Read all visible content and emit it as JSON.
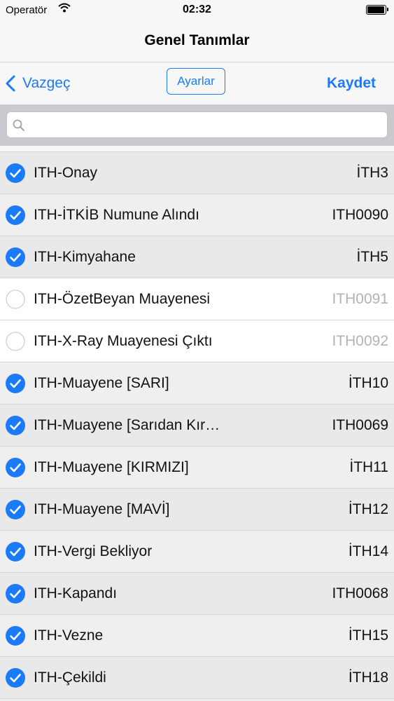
{
  "status_bar": {
    "carrier": "Operatör",
    "time": "02:32",
    "wifi_icon": "wifi-icon",
    "battery_icon": "battery-icon"
  },
  "title": "Genel Tanımlar",
  "toolbar": {
    "back_label": "Vazgeç",
    "settings_label": "Ayarlar",
    "save_label": "Kaydet"
  },
  "search": {
    "placeholder": "",
    "value": ""
  },
  "colors": {
    "accent": "#1a7af8",
    "muted_text": "#b3b3b3"
  },
  "items": [
    {
      "name": "ITH-Onay",
      "code": "İTH3",
      "checked": true
    },
    {
      "name": "ITH-İTKİB Numune Alındı",
      "code": "ITH0090",
      "checked": true
    },
    {
      "name": "ITH-Kimyahane",
      "code": "İTH5",
      "checked": true
    },
    {
      "name": "ITH-ÖzetBeyan Muayenesi",
      "code": "ITH0091",
      "checked": false
    },
    {
      "name": "ITH-X-Ray Muayenesi Çıktı",
      "code": "ITH0092",
      "checked": false
    },
    {
      "name": "ITH-Muayene [SARI]",
      "code": "İTH10",
      "checked": true
    },
    {
      "name": "ITH-Muayene [Sarıdan Kır…",
      "code": "ITH0069",
      "checked": true
    },
    {
      "name": "ITH-Muayene [KIRMIZI]",
      "code": "İTH11",
      "checked": true
    },
    {
      "name": "ITH-Muayene [MAVİ]",
      "code": "İTH12",
      "checked": true
    },
    {
      "name": "ITH-Vergi Bekliyor",
      "code": "İTH14",
      "checked": true
    },
    {
      "name": "ITH-Kapandı",
      "code": "ITH0068",
      "checked": true
    },
    {
      "name": "ITH-Vezne",
      "code": "İTH15",
      "checked": true
    },
    {
      "name": "ITH-Çekildi",
      "code": "İTH18",
      "checked": true
    }
  ]
}
